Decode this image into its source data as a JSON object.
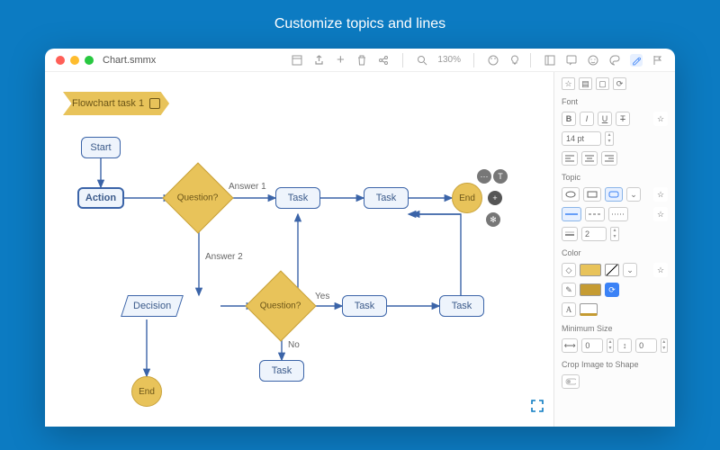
{
  "banner": {
    "title": "Customize topics and lines"
  },
  "window": {
    "filename": "Chart.smmx",
    "toolbar": {
      "zoom_label": "130%"
    }
  },
  "flowchart": {
    "tag_label": "Flowchart task 1",
    "nodes": {
      "start": "Start",
      "action": "Action",
      "question1": "Question?",
      "answer1": "Answer 1",
      "answer2": "Answer 2",
      "task1": "Task",
      "task2": "Task",
      "end1": "End",
      "decision": "Decision",
      "question2": "Question?",
      "yes": "Yes",
      "no": "No",
      "task3": "Task",
      "task4": "Task",
      "task5": "Task",
      "end2": "End"
    }
  },
  "sidebar": {
    "font_label": "Font",
    "bold": "B",
    "italic": "I",
    "underline": "U",
    "strike": "T",
    "size_value": "14 pt",
    "topic_label": "Topic",
    "border_width_value": "2",
    "color_label": "Color",
    "minsize_label": "Minimum Size",
    "minsize_w": "0",
    "minsize_h": "0",
    "crop_label": "Crop Image to Shape",
    "swatches": {
      "fill": "#e8c35a",
      "fill_dark": "#c59b32",
      "stroke": "#111111"
    }
  }
}
